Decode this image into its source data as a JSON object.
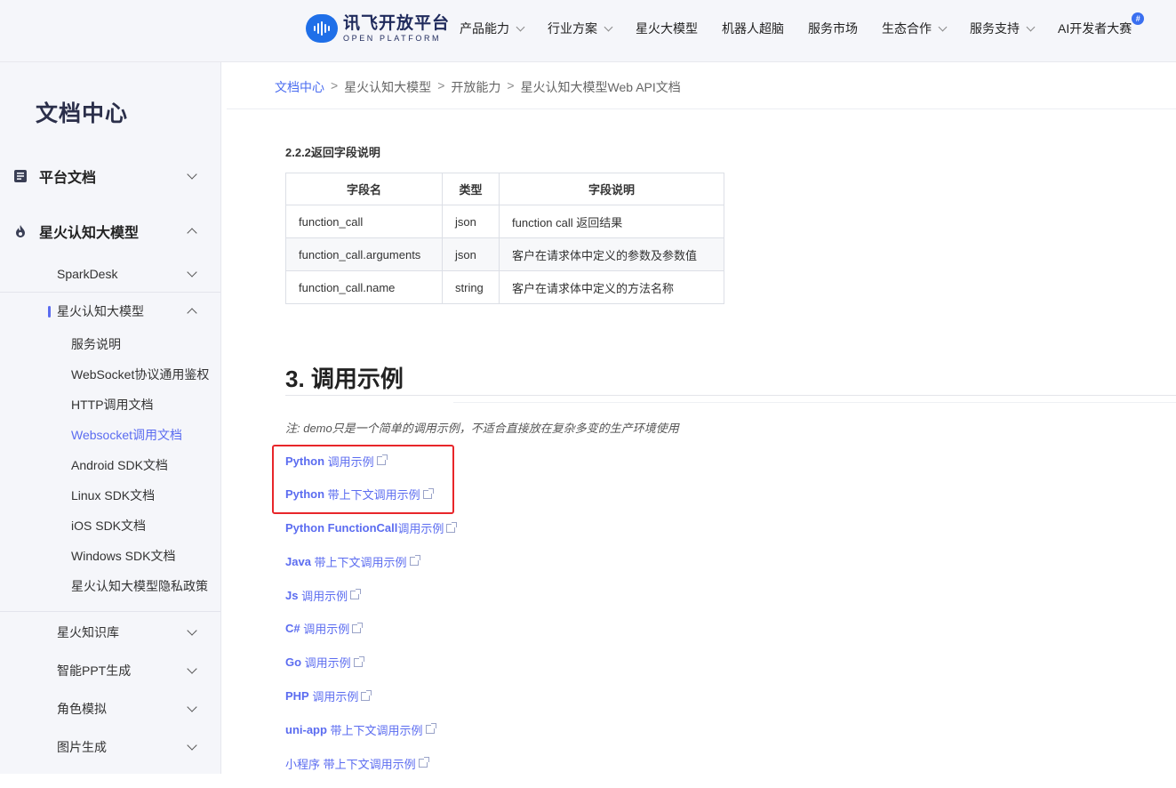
{
  "header": {
    "logo_cn": "讯飞开放平台",
    "logo_en": "OPEN PLATFORM",
    "nav": [
      {
        "label": "产品能力",
        "dropdown": true
      },
      {
        "label": "行业方案",
        "dropdown": true
      },
      {
        "label": "星火大模型",
        "dropdown": false
      },
      {
        "label": "机器人超脑",
        "dropdown": false
      },
      {
        "label": "服务市场",
        "dropdown": false
      },
      {
        "label": "生态合作",
        "dropdown": true
      },
      {
        "label": "服务支持",
        "dropdown": true
      },
      {
        "label": "AI开发者大赛",
        "dropdown": false,
        "badge": "#"
      }
    ]
  },
  "sidebar": {
    "title": "文档中心",
    "sections": {
      "platform_docs": "平台文档",
      "spark_model": "星火认知大模型",
      "sparkdesk": "SparkDesk",
      "spark_model_sub": "星火认知大模型",
      "items": [
        "服务说明",
        "WebSocket协议通用鉴权",
        "HTTP调用文档",
        "Websocket调用文档",
        "Android SDK文档",
        "Linux SDK文档",
        "iOS SDK文档",
        "Windows SDK文档",
        "星火认知大模型隐私政策"
      ],
      "active_item": "Websocket调用文档",
      "knowledge": "星火知识库",
      "ppt": "智能PPT生成",
      "role": "角色模拟",
      "image": "图片生成"
    }
  },
  "breadcrumb": [
    "文档中心",
    "星火认知大模型",
    "开放能力",
    "星火认知大模型Web API文档"
  ],
  "section_222": {
    "heading": "2.2.2返回字段说明",
    "columns": [
      "字段名",
      "类型",
      "字段说明"
    ],
    "rows": [
      [
        "function_call",
        "json",
        "function call 返回结果"
      ],
      [
        "function_call.arguments",
        "json",
        "客户在请求体中定义的参数及参数值"
      ],
      [
        "function_call.name",
        "string",
        "客户在请求体中定义的方法名称"
      ]
    ]
  },
  "section_3": {
    "heading": "3. 调用示例",
    "note": "注: demo只是一个简单的调用示例，不适合直接放在复杂多变的生产环境使用",
    "links": [
      {
        "lang": "Python",
        "text": " 调用示例"
      },
      {
        "lang": "Python",
        "text": " 带上下文调用示例"
      },
      {
        "lang": "Python FunctionCall",
        "text": "调用示例"
      },
      {
        "lang": "Java",
        "text": " 带上下文调用示例"
      },
      {
        "lang": "Js",
        "text": " 调用示例"
      },
      {
        "lang": "C#",
        "text": " 调用示例"
      },
      {
        "lang": "Go",
        "text": " 调用示例"
      },
      {
        "lang": "PHP",
        "text": " 调用示例"
      },
      {
        "lang": "uni-app",
        "text": " 带上下文调用示例"
      },
      {
        "lang": "小程序",
        "text": " 带上下文调用示例"
      }
    ]
  },
  "colors": {
    "accent": "#5b6cf0",
    "highlight": "#e8262a",
    "brand": "#1f6fe8"
  }
}
